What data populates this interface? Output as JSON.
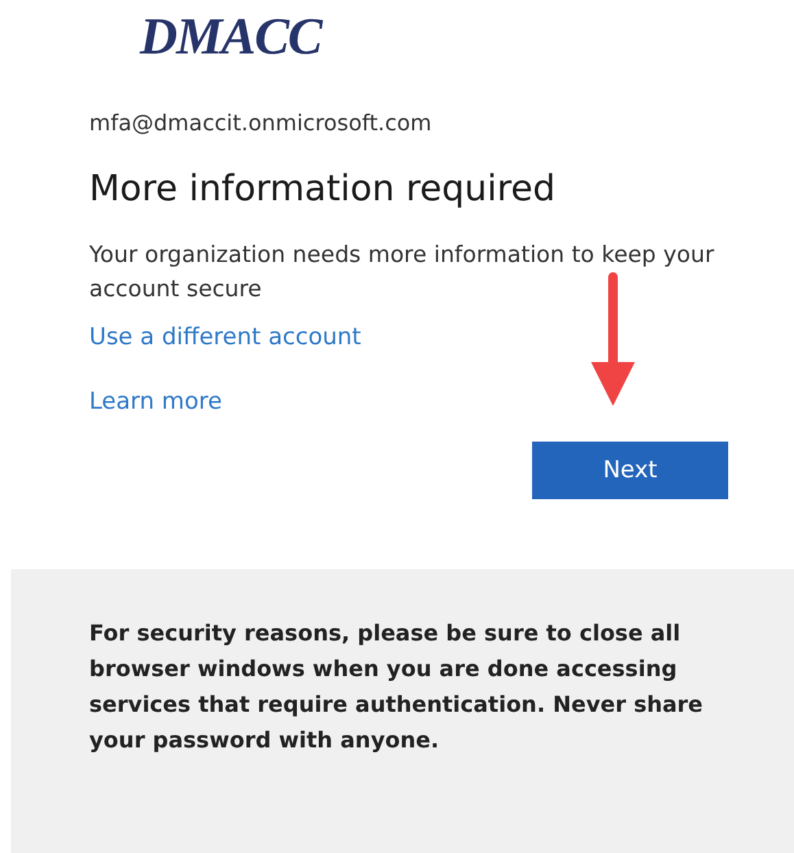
{
  "logo": {
    "text": "DMACC"
  },
  "account": "mfa@dmaccit.onmicrosoft.com",
  "title": "More information required",
  "description": "Your organization needs more information to keep your account secure",
  "links": [
    "Use a different account",
    "Learn more"
  ],
  "button": {
    "label": "Next"
  },
  "notice": "For security reasons, please be sure to close all browser windows when you are done accessing services that require authentication. Never share your password with anyone."
}
